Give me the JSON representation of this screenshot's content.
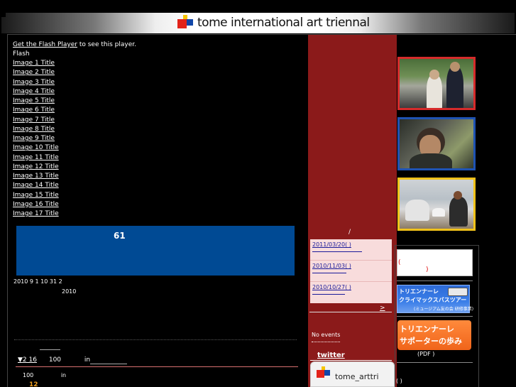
{
  "header": {
    "logo_text": "tome international art triennal"
  },
  "flash": {
    "get_player_link": "Get the Flash Player",
    "get_player_suffix": " to see this player.",
    "flash_label": "Flash",
    "image_titles": [
      "Image 1 Title",
      "Image 2 Title",
      "Image 3 Title",
      "Image 4 Title",
      "Image 5 Title",
      "Image 6 Title",
      "Image 7 Title",
      "Image 8 Title",
      "Image 9 Title",
      "Image 10 Title",
      "Image 11 Title",
      "Image 12 Title",
      "Image 13 Title",
      "Image 14 Title",
      "Image 15 Title",
      "Image 16 Title",
      "Image 17 Title"
    ]
  },
  "banner": {
    "number": "61",
    "color": "#004a94"
  },
  "period": {
    "line1": "2010 9 1   10 31   2",
    "line2": "2010"
  },
  "news": {
    "arrow": "▼",
    "item": "2 16",
    "count": "100",
    "in_label": "in",
    "stat_count": "100",
    "stat_in": "in",
    "highlight": "12"
  },
  "sidebar_mid": {
    "slash": "/",
    "entries": [
      {
        "date": "2011/03/20( )"
      },
      {
        "date": "2010/11/03( )"
      },
      {
        "date": "2010/10/27( )"
      }
    ],
    "more_link": ">",
    "no_events": "No events",
    "twitter_heading": "twitter",
    "twitter_account": "tome_arttri"
  },
  "sidebar_right": {
    "photos": [
      "photo-event-1",
      "photo-event-2",
      "photo-event-3"
    ],
    "white_box_paren_open": "(",
    "white_box_paren_close": ")",
    "bus_banner_line1": "トリエンナーレ",
    "bus_banner_line2": "クライマックスバスツアー",
    "bus_banner_line3": "(ミュージアム友の会 研修事業)",
    "orange_banner_line1": "トリエンナーレ",
    "orange_banner_line2": "サポーターの歩み",
    "pdf_label": "(PDF          )",
    "bottom_paren": "(      )"
  },
  "colors": {
    "accent_red": "#8b1a1a",
    "pink_panel": "#f8dcdc",
    "photo_border_1": "#d62b2b",
    "photo_border_2": "#1f53b3",
    "photo_border_3": "#f0c21a"
  }
}
